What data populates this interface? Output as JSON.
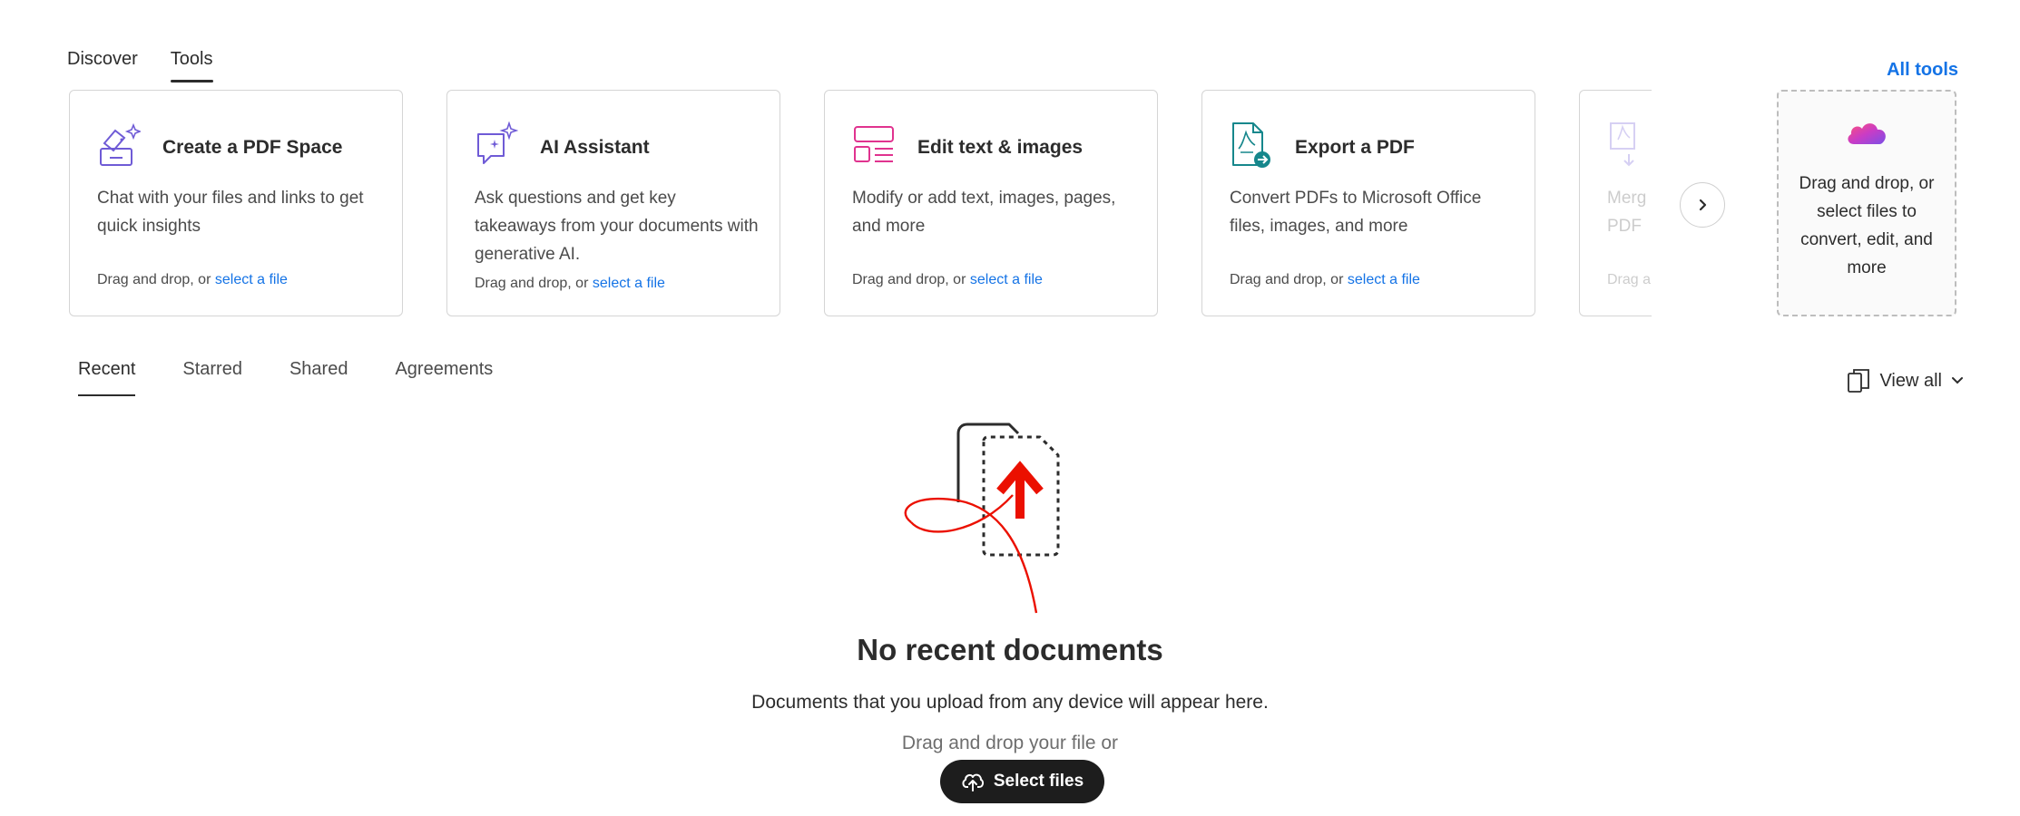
{
  "top_tabs": [
    {
      "label": "Discover",
      "active": false
    },
    {
      "label": "Tools",
      "active": true
    }
  ],
  "all_tools_label": "All tools",
  "cards": [
    {
      "icon": "pdf-space-icon",
      "title": "Create a PDF Space",
      "description": "Chat with your files and links to get quick insights",
      "drop_prefix": "Drag and drop, or ",
      "drop_link": "select a file"
    },
    {
      "icon": "ai-assistant-icon",
      "title": "AI Assistant",
      "description": "Ask questions and get key takeaways from your documents with generative AI.",
      "drop_prefix": "Drag and drop, or ",
      "drop_link": "select a file"
    },
    {
      "icon": "edit-text-images-icon",
      "title": "Edit text & images",
      "description": "Modify or add text, images, pages, and more",
      "drop_prefix": "Drag and drop, or ",
      "drop_link": "select a file"
    },
    {
      "icon": "export-pdf-icon",
      "title": "Export a PDF",
      "description": "Convert PDFs to Microsoft Office files, images, and more",
      "drop_prefix": "Drag and drop, or ",
      "drop_link": "select a file"
    },
    {
      "icon": "merge-pdf-icon",
      "title": "",
      "description": "Merg PDF",
      "drop_prefix": "Drag a",
      "drop_link": ""
    }
  ],
  "dropzone": {
    "icon": "cloud-icon",
    "text": "Drag and drop, or select files to convert, edit, and more"
  },
  "doc_tabs": [
    {
      "label": "Recent",
      "active": true
    },
    {
      "label": "Starred",
      "active": false
    },
    {
      "label": "Shared",
      "active": false
    },
    {
      "label": "Agreements",
      "active": false
    }
  ],
  "view_all_label": "View all",
  "empty_state": {
    "title": "No recent documents",
    "subtitle": "Documents that you upload from any device will appear here.",
    "drag_text": "Drag and drop your file or",
    "button_label": "Select files"
  },
  "colors": {
    "accent": "#1473e6",
    "brand_red": "#eb1000",
    "icon_purple": "#6f5bd6",
    "icon_pink": "#e0338f",
    "icon_teal": "#16878c",
    "button_dark": "#1d1d1d"
  }
}
